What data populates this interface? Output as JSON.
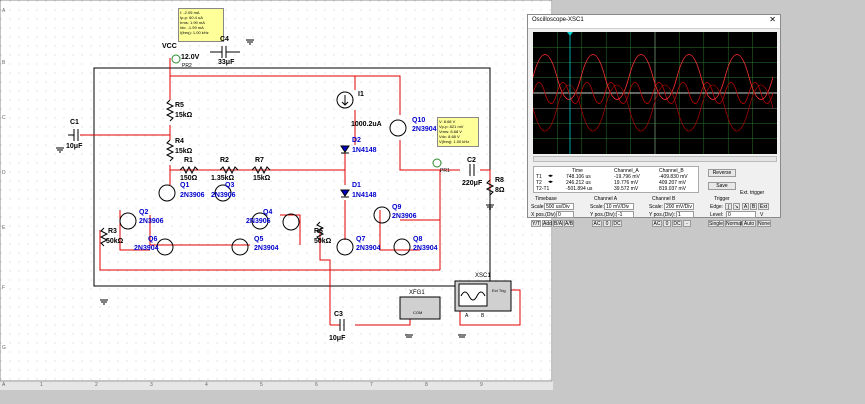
{
  "colors": {
    "wire": "#e00000",
    "component": "#000000",
    "label_blue": "#0000cc",
    "scope_bg": "#000000",
    "trace_a": "#b00000",
    "grid": "#2a7a2a"
  },
  "probes": {
    "i_probe": [
      "I: -2.05 mA",
      "Ip-p: 60.4 uA",
      "Irms: 1.99 mA",
      "Idc: -1.99 mA",
      "I(freq): 1.00 kHz"
    ],
    "v_probe": [
      "V: 8.68 V",
      "Vp-p: 821 mV",
      "Vrms: 8.68 V",
      "Vdc: 8.68 V",
      "V(freq): 1.00 kHz"
    ]
  },
  "components": {
    "vcc": "VCC",
    "vcc_val": "12.0V",
    "pr2": "PR2",
    "c4": "C4",
    "c4_val": "33μF",
    "r5": "R5",
    "r5_val": "15kΩ",
    "r4": "R4",
    "r4_val": "15kΩ",
    "r1": "R1",
    "r1_val": "150Ω",
    "r2": "R2",
    "r2_val": "1.35kΩ",
    "r7": "R7",
    "r7_val": "15kΩ",
    "c1": "C1",
    "c1_val": "10μF",
    "i1": "I1",
    "i1_val": "1000.2uA",
    "d2": "D2",
    "d2_val": "1N4148",
    "d1": "D1",
    "d1_val": "1N4148",
    "q10": "Q10",
    "q10_val": "2N3904",
    "q1": "Q1",
    "q1_val": "2N3906",
    "q3": "Q3",
    "q3_val": "2N3906",
    "q2": "Q2",
    "q2_val": "2N3906",
    "q4": "Q4",
    "q4_val": "2N3906",
    "q6": "Q6",
    "q6_val": "2N3904",
    "q5": "Q5",
    "q5_val": "2N3904",
    "q7": "Q7",
    "q7_val": "2N3904",
    "q8": "Q8",
    "q8_val": "2N3904",
    "q9": "Q9",
    "q9_val": "2N3906",
    "r3": "R3",
    "r3_val": "50kΩ",
    "r6": "R6",
    "r6_val": "50kΩ",
    "c2": "C2",
    "c2_val": "220μF",
    "r8": "R8",
    "r8_val": "8Ω",
    "pr1": "PR1",
    "c3": "C3",
    "c3_val": "10μF",
    "xfg1": "XFG1",
    "xsc1": "XSC1",
    "a_lbl": "A",
    "b_lbl": "B",
    "ext_trig": "Ext Trig",
    "com": "COM"
  },
  "scope": {
    "title": "Oscilloscope-XSC1",
    "headers": [
      "Time",
      "Channel_A",
      "Channel_B"
    ],
    "rows": [
      {
        "label": "T1",
        "time": "748.106 us",
        "a": "-19.796 mV",
        "b": "-409.830 mV"
      },
      {
        "label": "T2",
        "time": "246.212 us",
        "a": "19.776 mV",
        "b": "409.207 mV"
      },
      {
        "label": "T2-T1",
        "time": "-501.894 us",
        "a": "39.572 mV",
        "b": "819.037 mV"
      }
    ],
    "reverse": "Reverse",
    "save": "Save",
    "ext_trigger": "Ext. trigger",
    "timebase": {
      "label": "Timebase",
      "scale_lbl": "Scale:",
      "scale": "500 us/Div",
      "xpos_lbl": "X pos.(Div):",
      "xpos": "0",
      "modes": [
        "Y/T",
        "Add",
        "B/A",
        "A/B"
      ]
    },
    "cha": {
      "label": "Channel A",
      "scale_lbl": "Scale:",
      "scale": "10 mV/Div",
      "ypos_lbl": "Y pos.(Div):",
      "ypos": "-1",
      "modes": [
        "AC",
        "0",
        "DC"
      ]
    },
    "chb": {
      "label": "Channel B",
      "scale_lbl": "Scale:",
      "scale": "200 mV/Div",
      "ypos_lbl": "Y pos.(Div):",
      "ypos": "1",
      "modes": [
        "AC",
        "0",
        "DC",
        "-"
      ]
    },
    "trigger": {
      "label": "Trigger",
      "edge_lbl": "Edge:",
      "edges": [
        "A",
        "B",
        "Ext"
      ],
      "level_lbl": "Level:",
      "level": "0",
      "unit": "V",
      "modes": [
        "Single",
        "Normal",
        "Auto",
        "None"
      ]
    }
  },
  "ruler": {
    "cols": [
      "A",
      "1",
      "2",
      "3",
      "4",
      "5",
      "6",
      "7",
      "8",
      "9"
    ],
    "rows": [
      "A",
      "B",
      "C",
      "D",
      "E",
      "F",
      "G"
    ]
  }
}
